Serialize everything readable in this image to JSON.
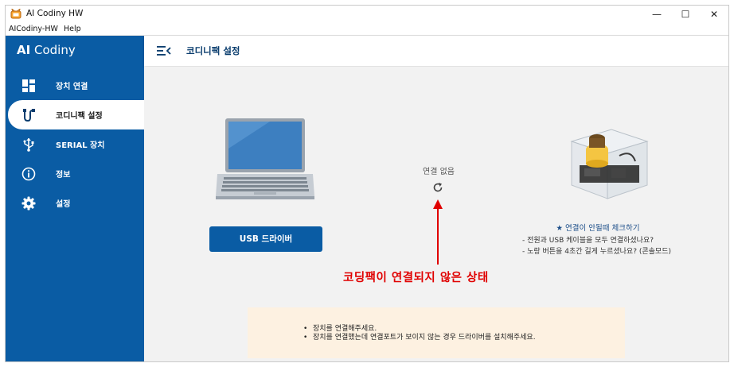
{
  "window": {
    "title": "AI Codiny HW",
    "minimize_glyph": "—",
    "maximize_glyph": "☐",
    "close_glyph": "✕"
  },
  "menubar": {
    "items": [
      "AICodiny-HW",
      "Help"
    ]
  },
  "sidebar": {
    "brand_bold": "AI",
    "brand_rest": "Codiny",
    "items": [
      {
        "label": "장치 연결",
        "icon": "dashboard-icon"
      },
      {
        "label": "코디니팩 설정",
        "icon": "cable-icon",
        "active": true
      },
      {
        "label": "SERIAL 장치",
        "icon": "usb-icon"
      },
      {
        "label": "정보",
        "icon": "info-icon"
      },
      {
        "label": "설정",
        "icon": "gear-icon"
      }
    ]
  },
  "header": {
    "title": "코디니팩 설정",
    "toggle_icon": "menu-collapse-icon"
  },
  "main": {
    "usb_button": "USB 드라이버",
    "status": "연결 없음",
    "annotation": "코딩팩이 연결되지 않은 상태",
    "help": {
      "title": "★ 연결이 안될때 체크하기",
      "lines": [
        "- 전원과 USB 케이블을 모두 연결하셨나요?",
        "- 노랑 버튼을 4초간 길게 누르셨나요? (콘솔모드)"
      ]
    },
    "notice": [
      "장치를 연결해주세요.",
      "장치를 연결했는데 연결포트가 보이지 않는 경우 드라이버를 설치해주세요."
    ]
  },
  "colors": {
    "sidebar_bg": "#0a5ca4",
    "annotation": "#e00000",
    "notice_bg": "#fdf1e1"
  }
}
